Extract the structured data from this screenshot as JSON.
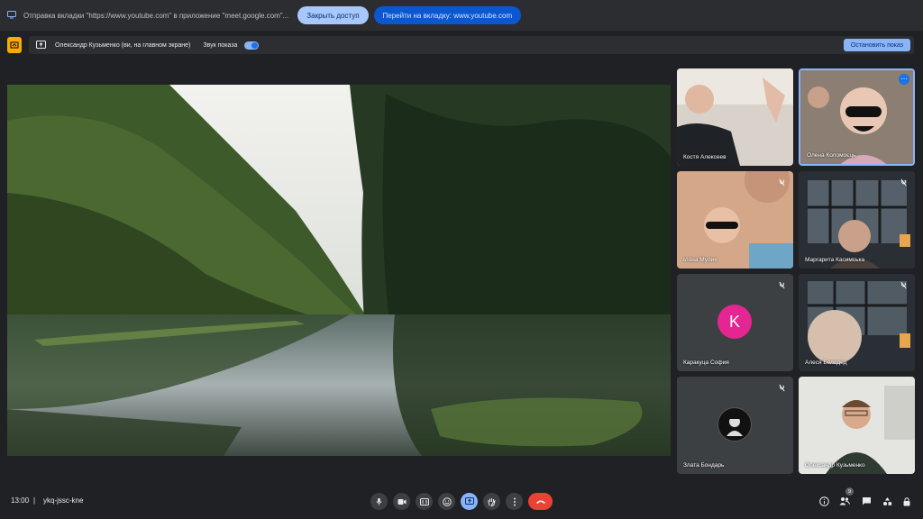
{
  "share_bar": {
    "message": "Отправка вкладки \"https://www.youtube.com\" в приложение \"meet.google.com\"...",
    "close_access_label": "Закрыть доступ",
    "goto_tab_label": "Перейти на вкладку: www.youtube.com"
  },
  "presenting_bar": {
    "presenter": "Олександр Кузьменко (ви, на главном экране)",
    "sound_label": "Звук показа",
    "stop_label": "Остановить показ"
  },
  "participants": [
    {
      "name": "Костя Алексеев"
    },
    {
      "name": "Олена Коломоєць"
    },
    {
      "name": "Ілона Мулик"
    },
    {
      "name": "Маргарита Касимська"
    },
    {
      "name": "Каракуца София",
      "initial": "K",
      "avatar_color": "#e52592"
    },
    {
      "name": "Алеся Белодед"
    },
    {
      "name": "Злата Бондарь"
    },
    {
      "name": "Олександр Кузьменко"
    }
  ],
  "footer": {
    "time": "13:00",
    "separator": "|",
    "meeting_code": "ykq-jssc-kne",
    "participant_count": "9"
  },
  "colors": {
    "background": "#202124",
    "accent": "#8ab4f8",
    "end_call": "#ea4335"
  }
}
